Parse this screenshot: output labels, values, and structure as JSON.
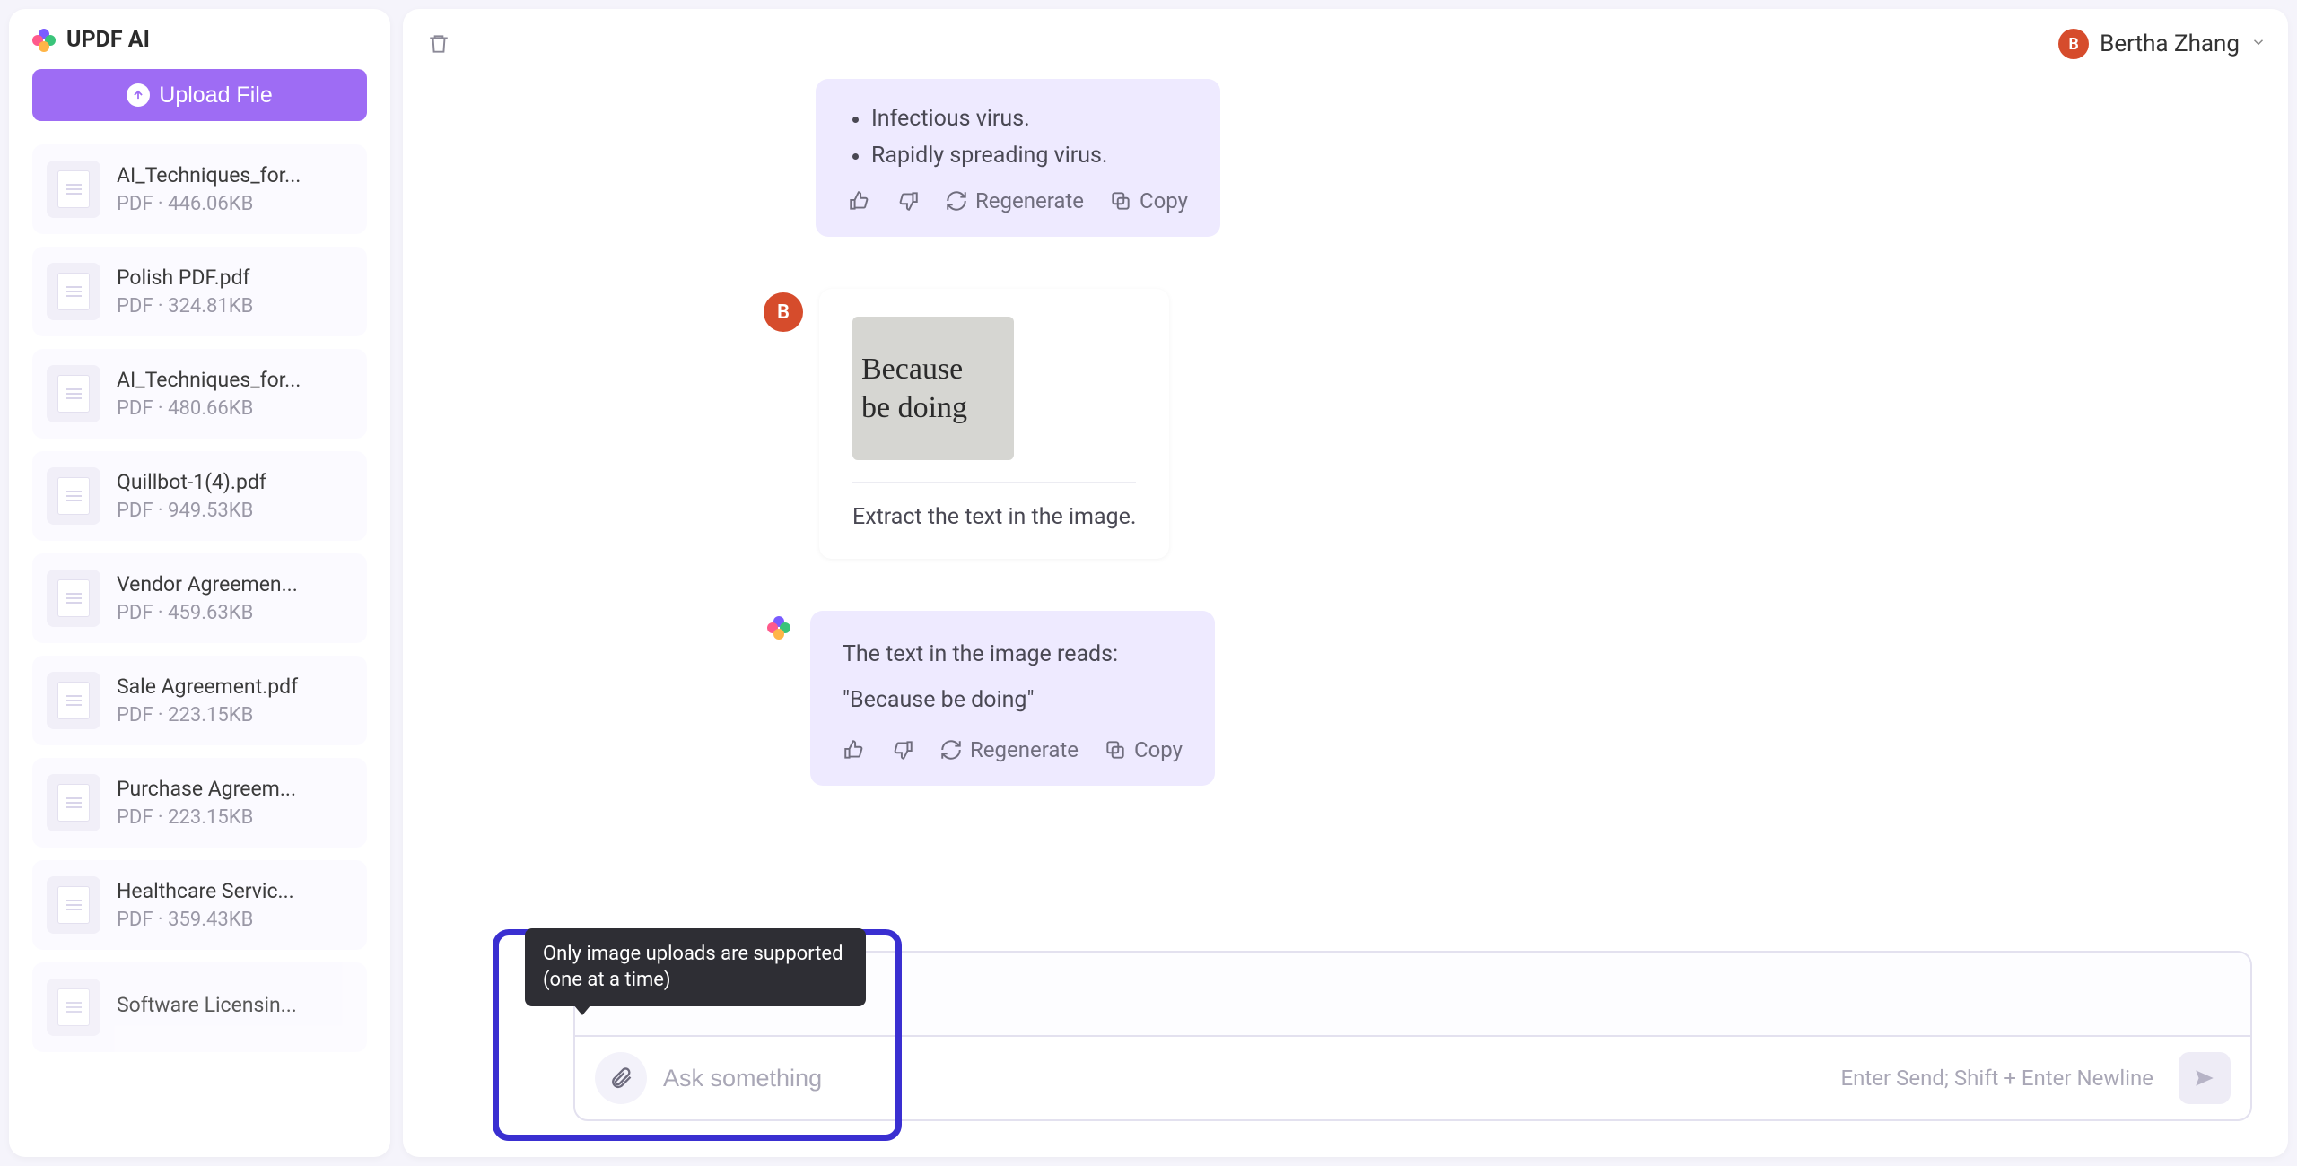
{
  "brand": "UPDF AI",
  "upload_label": "Upload File",
  "files": [
    {
      "name": "AI_Techniques_for...",
      "meta": "PDF · 446.06KB"
    },
    {
      "name": "Polish PDF.pdf",
      "meta": "PDF · 324.81KB"
    },
    {
      "name": "AI_Techniques_for...",
      "meta": "PDF · 480.66KB"
    },
    {
      "name": "Quillbot-1(4).pdf",
      "meta": "PDF · 949.53KB"
    },
    {
      "name": "Vendor Agreemen...",
      "meta": "PDF · 459.63KB"
    },
    {
      "name": "Sale Agreement.pdf",
      "meta": "PDF · 223.15KB"
    },
    {
      "name": "Purchase Agreem...",
      "meta": "PDF · 223.15KB"
    },
    {
      "name": "Healthcare Servic...",
      "meta": "PDF · 359.43KB"
    },
    {
      "name": "Software Licensin...",
      "meta": ""
    }
  ],
  "user": {
    "initial": "B",
    "name": "Bertha Zhang"
  },
  "chat": {
    "assistant1": {
      "bullets": [
        "Infectious virus.",
        "Rapidly spreading virus."
      ]
    },
    "user1": {
      "avatar_initial": "B",
      "image_text_line1": "Because",
      "image_text_line2": "be doing",
      "prompt": "Extract the text in the image."
    },
    "assistant2": {
      "line1": "The text in the image reads:",
      "line2": "\"Because be doing\""
    },
    "actions": {
      "regen": "Regenerate",
      "copy": "Copy"
    }
  },
  "tooltip": "Only image uploads are supported  (one at a time)",
  "input": {
    "placeholder": "Ask something",
    "hint": "Enter Send; Shift + Enter Newline"
  }
}
